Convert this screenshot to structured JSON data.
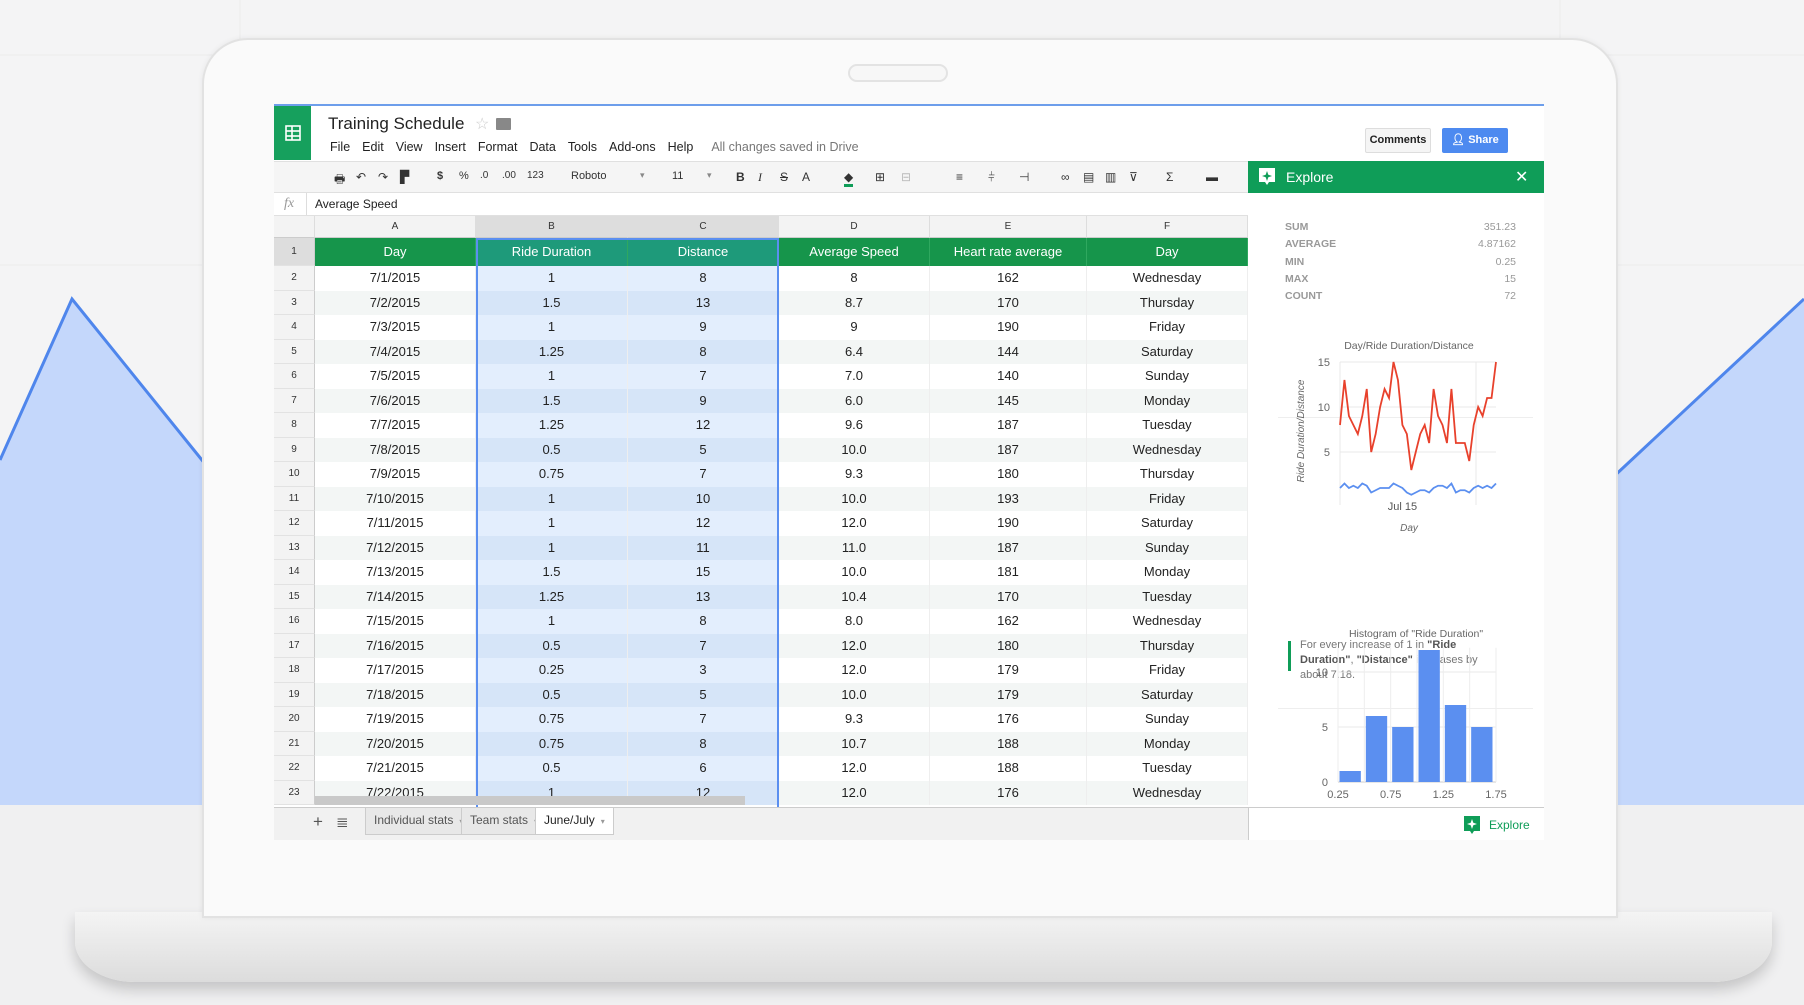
{
  "app": {
    "title": "Training Schedule",
    "save_status": "All changes saved in Drive",
    "menu": [
      "File",
      "Edit",
      "View",
      "Insert",
      "Format",
      "Data",
      "Tools",
      "Add-ons",
      "Help"
    ],
    "comments_label": "Comments",
    "share_label": "Share"
  },
  "toolbar": {
    "font": "Roboto",
    "font_size": "11",
    "currency": "$",
    "percent": "%",
    "decrease_decimal": ".0",
    "increase_decimal": ".00",
    "more_formats": "123",
    "bold": "B",
    "italic": "I",
    "strike": "S",
    "text_color": "A",
    "functions": "Σ"
  },
  "formula_bar": {
    "fx": "fx",
    "value": "Average Speed"
  },
  "grid": {
    "columns": [
      "A",
      "B",
      "C",
      "D",
      "E",
      "F"
    ],
    "headers": [
      "Day",
      "Ride Duration",
      "Distance",
      "Average Speed",
      "Heart rate average",
      "Day"
    ],
    "rows": [
      [
        "7/1/2015",
        "1",
        "8",
        "8",
        "162",
        "Wednesday"
      ],
      [
        "7/2/2015",
        "1.5",
        "13",
        "8.7",
        "170",
        "Thursday"
      ],
      [
        "7/3/2015",
        "1",
        "9",
        "9",
        "190",
        "Friday"
      ],
      [
        "7/4/2015",
        "1.25",
        "8",
        "6.4",
        "144",
        "Saturday"
      ],
      [
        "7/5/2015",
        "1",
        "7",
        "7.0",
        "140",
        "Sunday"
      ],
      [
        "7/6/2015",
        "1.5",
        "9",
        "6.0",
        "145",
        "Monday"
      ],
      [
        "7/7/2015",
        "1.25",
        "12",
        "9.6",
        "187",
        "Tuesday"
      ],
      [
        "7/8/2015",
        "0.5",
        "5",
        "10.0",
        "187",
        "Wednesday"
      ],
      [
        "7/9/2015",
        "0.75",
        "7",
        "9.3",
        "180",
        "Thursday"
      ],
      [
        "7/10/2015",
        "1",
        "10",
        "10.0",
        "193",
        "Friday"
      ],
      [
        "7/11/2015",
        "1",
        "12",
        "12.0",
        "190",
        "Saturday"
      ],
      [
        "7/12/2015",
        "1",
        "11",
        "11.0",
        "187",
        "Sunday"
      ],
      [
        "7/13/2015",
        "1.5",
        "15",
        "10.0",
        "181",
        "Monday"
      ],
      [
        "7/14/2015",
        "1.25",
        "13",
        "10.4",
        "170",
        "Tuesday"
      ],
      [
        "7/15/2015",
        "1",
        "8",
        "8.0",
        "162",
        "Wednesday"
      ],
      [
        "7/16/2015",
        "0.5",
        "7",
        "12.0",
        "180",
        "Thursday"
      ],
      [
        "7/17/2015",
        "0.25",
        "3",
        "12.0",
        "179",
        "Friday"
      ],
      [
        "7/18/2015",
        "0.5",
        "5",
        "10.0",
        "179",
        "Saturday"
      ],
      [
        "7/19/2015",
        "0.75",
        "7",
        "9.3",
        "176",
        "Sunday"
      ],
      [
        "7/20/2015",
        "0.75",
        "8",
        "10.7",
        "188",
        "Monday"
      ],
      [
        "7/21/2015",
        "0.5",
        "6",
        "12.0",
        "188",
        "Tuesday"
      ],
      [
        "7/22/2015",
        "1",
        "12",
        "12.0",
        "176",
        "Wednesday"
      ]
    ]
  },
  "sheet_tabs": [
    {
      "label": "Individual stats",
      "active": false
    },
    {
      "label": "Team stats",
      "active": false
    },
    {
      "label": "June/July",
      "active": true
    }
  ],
  "explore": {
    "title": "Explore",
    "stats": [
      {
        "label": "SUM",
        "value": "351.23"
      },
      {
        "label": "AVERAGE",
        "value": "4.87162"
      },
      {
        "label": "MIN",
        "value": "0.25"
      },
      {
        "label": "MAX",
        "value": "15"
      },
      {
        "label": "COUNT",
        "value": "72"
      }
    ],
    "insight_parts": [
      "For every increase of 1 in ",
      "\"Ride Duration\"",
      ", ",
      "\"Distance\"",
      " increases by about 7.18."
    ],
    "footer_label": "Explore"
  },
  "colors": {
    "brand_green": "#0f9d58",
    "header_green": "#16954b",
    "selection_blue": "#5b8ff0",
    "share_blue": "#4d8af0",
    "line_red": "#e8412c",
    "line_blue": "#5b8ff0",
    "bar_blue": "#5b8ff0"
  },
  "chart_data": [
    {
      "type": "line",
      "title": "Day/Ride Duration/Distance",
      "xlabel": "Day",
      "ylabel": "Ride Duration/Distance",
      "x_tick_labels": [
        "Jul 15"
      ],
      "y_ticks": [
        "5",
        "10",
        "15"
      ],
      "ylim": [
        0,
        15
      ],
      "grid": true,
      "x": [
        "7/1",
        "7/2",
        "7/3",
        "7/4",
        "7/5",
        "7/6",
        "7/7",
        "7/8",
        "7/9",
        "7/10",
        "7/11",
        "7/12",
        "7/13",
        "7/14",
        "7/15",
        "7/16",
        "7/17",
        "7/18",
        "7/19",
        "7/20",
        "7/21",
        "7/22",
        "7/23",
        "7/24",
        "7/25",
        "7/26",
        "7/27",
        "7/28",
        "7/29",
        "7/30",
        "7/31",
        "8/1",
        "8/2",
        "8/3",
        "8/4",
        "8/5"
      ],
      "series": [
        {
          "values": [
            8,
            13,
            9,
            8,
            7,
            9,
            12,
            5,
            7,
            10,
            12,
            11,
            15,
            13,
            8,
            7,
            3,
            5,
            7,
            8,
            6,
            12,
            9,
            8,
            6,
            12,
            6,
            6,
            6,
            4,
            8,
            10,
            9,
            11,
            11,
            15
          ]
        },
        {
          "values": [
            1,
            1.5,
            1,
            1.25,
            1,
            1.5,
            1.25,
            0.5,
            0.75,
            1,
            1,
            1,
            1.5,
            1.25,
            1,
            0.5,
            0.25,
            0.5,
            0.75,
            0.75,
            0.5,
            1,
            1.25,
            1.25,
            1,
            1.5,
            0.5,
            0.75,
            0.75,
            0.5,
            1,
            1.25,
            1,
            1.25,
            1,
            1.5
          ]
        }
      ]
    },
    {
      "type": "bar",
      "title": "Histogram of \"Ride Duration\"",
      "x_tick_labels": [
        "0.25",
        "0.75",
        "1.25",
        "1.75"
      ],
      "y_ticks": [
        "0",
        "5",
        "10"
      ],
      "categories": [
        "0.25-0.5",
        "0.5-0.75",
        "0.75-1",
        "1-1.25",
        "1.25-1.5",
        "1.5-1.75"
      ],
      "values": [
        1,
        6,
        5,
        12,
        7,
        5
      ],
      "ylim": [
        0,
        12
      ],
      "grid": true
    }
  ]
}
